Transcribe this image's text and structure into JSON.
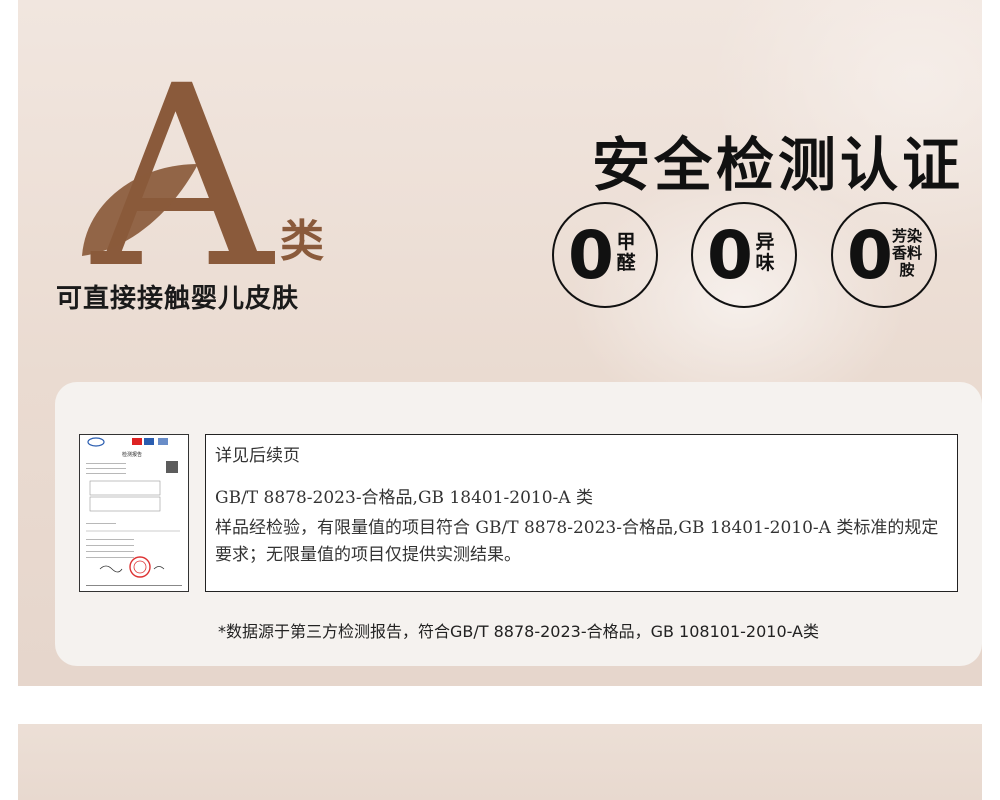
{
  "hero": {
    "grade_letter": "A",
    "grade_suffix": "类",
    "tagline": "可直接接触婴儿皮肤",
    "title": "安全检测认证"
  },
  "badges": [
    {
      "value": "0",
      "label": "甲醛"
    },
    {
      "value": "0",
      "label": "异味"
    },
    {
      "value": "0",
      "label": "芳染香料胺"
    }
  ],
  "report": {
    "see_more": "详见后续页",
    "standard": "GB/T 8878-2023-合格品,GB 18401-2010-A 类",
    "conclusion": "样品经检验，有限量值的项目符合 GB/T 8878-2023-合格品,GB 18401-2010-A 类标准的规定要求；无限量值的项目仅提供实测结果。",
    "thumb_title": "检测报告"
  },
  "footnote": "*数据源于第三方检测报告，符合GB/T 8878-2023-合格品，GB 108101-2010-A类",
  "colors": {
    "brand_brown": "#8a5a3b",
    "background": "#ecdfd6",
    "text": "#111111"
  }
}
